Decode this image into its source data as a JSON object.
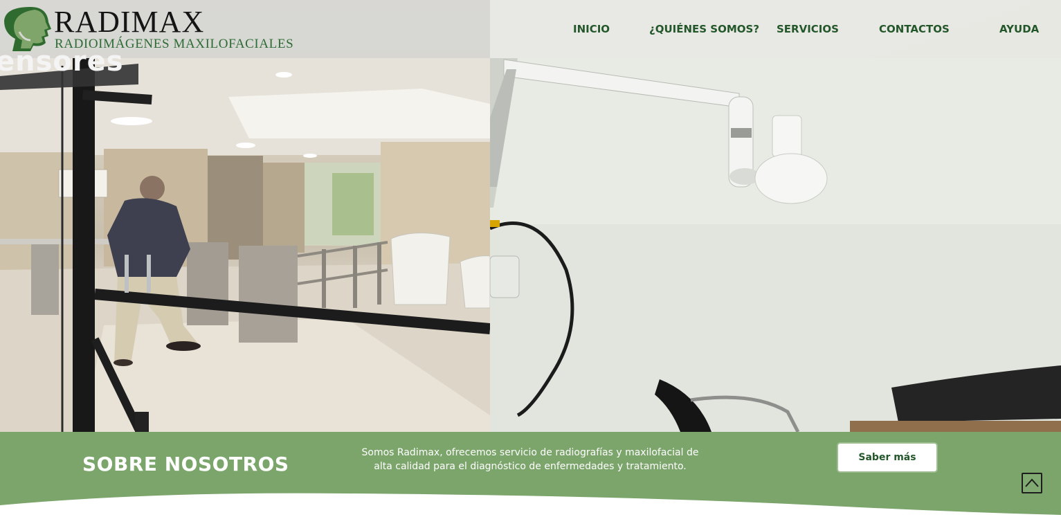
{
  "brand": {
    "title": "RADIMAX",
    "subtitle": "RADIOIMÁGENES MAXILOFACIALES",
    "logo_icon": "head-profile-icon"
  },
  "nav": {
    "items": [
      {
        "label": "INICIO"
      },
      {
        "label": "¿QUIÉNES SOMOS?"
      },
      {
        "label": "SERVICIOS"
      },
      {
        "label": "CONTACTOS"
      },
      {
        "label": "AYUDA"
      }
    ]
  },
  "hero": {
    "left_photo_sign": "ensores"
  },
  "about": {
    "title": "SOBRE NOSOTROS",
    "text": "Somos Radimax, ofrecemos servicio de radiografías y maxilofacial de alta calidad para el diagnóstico de enfermedades y tratamiento.",
    "button_label": "Saber más"
  },
  "scroll_top": {
    "icon": "chevron-up-icon"
  },
  "colors": {
    "nav_text": "#23572a",
    "band": "#7ba56b",
    "brand_sub": "#2e6b34"
  }
}
